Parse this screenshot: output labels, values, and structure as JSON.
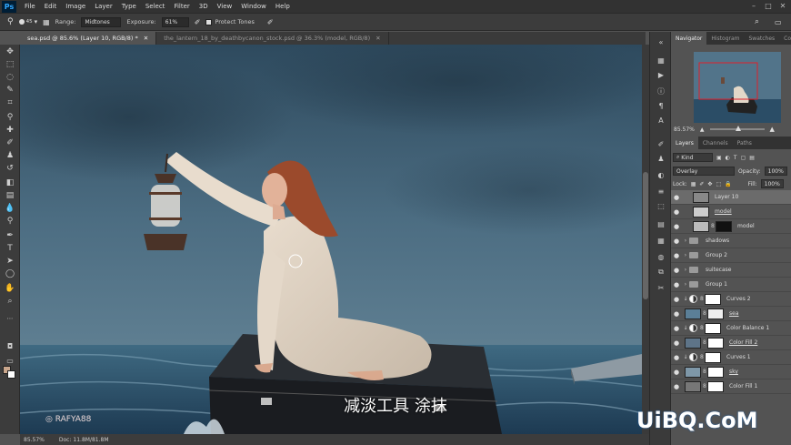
{
  "menu": {
    "items": [
      "File",
      "Edit",
      "Image",
      "Layer",
      "Type",
      "Select",
      "Filter",
      "3D",
      "View",
      "Window",
      "Help"
    ]
  },
  "options": {
    "brush_size": "45",
    "range_label": "Range:",
    "range_value": "Midtones",
    "exposure_label": "Exposure:",
    "exposure_value": "61%",
    "protect_tones": "Protect Tones"
  },
  "tabs": [
    {
      "label": "sea.psd @ 85.6% (Layer 10, RGB/8) *"
    },
    {
      "label": "the_lantern_18_by_deathbycanon_stock.psd @ 36.3% (model, RGB/8)"
    }
  ],
  "status": {
    "zoom": "85.57%",
    "doc": "Doc: 11.8M/81.8M"
  },
  "navigator": {
    "tabs": [
      "Navigator",
      "Histogram",
      "Swatches",
      "Color"
    ],
    "zoom": "85.57%"
  },
  "layers_panel": {
    "tabs": [
      "Layers",
      "Channels",
      "Paths"
    ],
    "kind": "Kind",
    "blend_mode": "Overlay",
    "opacity_label": "Opacity:",
    "opacity_value": "100%",
    "lock_label": "Lock:",
    "fill_label": "Fill:",
    "fill_value": "100%",
    "layers": [
      {
        "name": "Layer 10"
      },
      {
        "name": "model"
      },
      {
        "name": "model"
      },
      {
        "name": "shadows"
      },
      {
        "name": "Group 2"
      },
      {
        "name": "suitecase"
      },
      {
        "name": "Group 1"
      },
      {
        "name": "Curves 2"
      },
      {
        "name": "sea"
      },
      {
        "name": "Color Balance 1"
      },
      {
        "name": "Color Fill 2"
      },
      {
        "name": "Curves 1"
      },
      {
        "name": "sky"
      },
      {
        "name": "Color Fill 1"
      }
    ]
  },
  "overlay": {
    "subtitle": "减淡工具 涂抹",
    "watermark": "RAFYA88",
    "site": "UiBQ.CoM"
  },
  "colors": {
    "accent": "#31a8ff",
    "foreground": "#c9a68c",
    "background": "#ffffff"
  }
}
